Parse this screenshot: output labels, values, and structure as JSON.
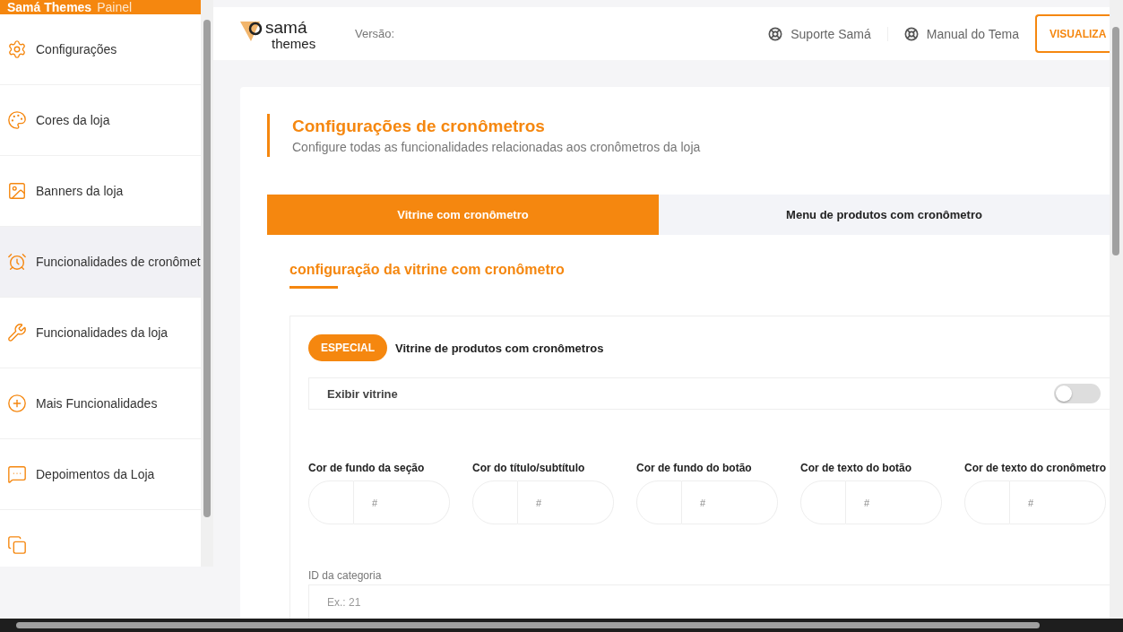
{
  "sidebar": {
    "brand": "Samá Themes",
    "brand_suffix": "Painel",
    "items": [
      {
        "label": "Configurações",
        "selected": false
      },
      {
        "label": "Cores da loja",
        "selected": false
      },
      {
        "label": "Banners da loja",
        "selected": false
      },
      {
        "label": "Funcionalidades de cronômet",
        "selected": true
      },
      {
        "label": "Funcionalidades da loja",
        "selected": false
      },
      {
        "label": "Mais Funcionalidades",
        "selected": false
      },
      {
        "label": "Depoimentos da Loja",
        "selected": false
      },
      {
        "selected": false
      }
    ]
  },
  "header": {
    "logo_top": "samá",
    "logo_bottom": "themes",
    "version_label": "Versão:",
    "links": [
      "Suporte Samá",
      "Manual do Tema"
    ],
    "button": "VISUALIZA"
  },
  "page": {
    "title": "Configurações de cronômetros",
    "subtitle": "Configure todas as funcionalidades relacionadas aos cronômetros da loja",
    "tabs": [
      {
        "label": "Vitrine com cronômetro",
        "selected": true
      },
      {
        "label": "Menu de produtos com cronômetro",
        "selected": false
      }
    ],
    "section_title": "configuração da vitrine com cronômetro",
    "badge": "ESPECIAL",
    "badge_text": "Vitrine de produtos com cronômetros",
    "toggle": {
      "label": "Exibir vitrine",
      "on": false
    },
    "colors": [
      {
        "label": "Cor de fundo da seção",
        "placeholder": "#"
      },
      {
        "label": "Cor do título/subtítulo",
        "placeholder": "#"
      },
      {
        "label": "Cor de fundo do botão",
        "placeholder": "#"
      },
      {
        "label": "Cor de texto do botão",
        "placeholder": "#"
      },
      {
        "label": "Cor de texto do cronômetro",
        "placeholder": "#"
      }
    ],
    "category": {
      "label": "ID da categoria",
      "placeholder": "Ex.: 21"
    }
  }
}
